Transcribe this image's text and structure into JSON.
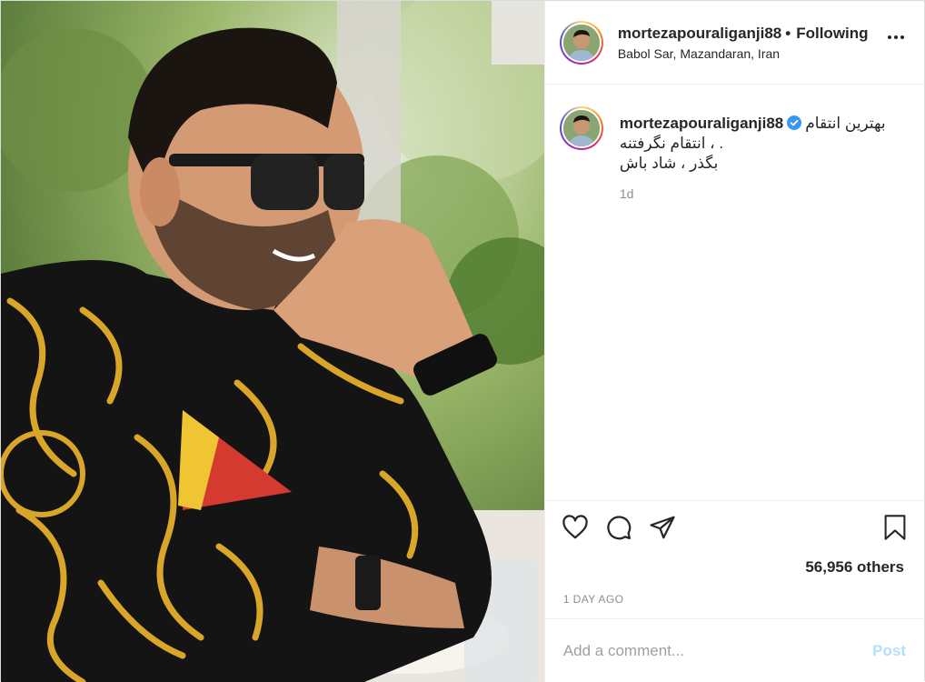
{
  "post": {
    "username": "mortezapouraliganji88",
    "separator": "•",
    "follow_status": "Following",
    "location": "Babol Sar, Mazandaran, Iran",
    "more_icon": "more-horizontal-icon",
    "verified_icon": "verified-badge-icon",
    "caption": {
      "username": "mortezapouraliganji88",
      "line1": "بهترین انتقام",
      "line2": ". ، انتقام نگرفتنه",
      "line3": "بگذر ، شاد باش",
      "time": "1d"
    },
    "actions": {
      "like_icon": "heart-icon",
      "comment_icon": "comment-icon",
      "share_icon": "share-icon",
      "save_icon": "bookmark-icon"
    },
    "likes": "56,956 others",
    "date": "1 DAY AGO",
    "comment_placeholder": "Add a comment...",
    "post_label": "Post"
  },
  "colors": {
    "accent": "#0095f6",
    "post_disabled": "#b2dffc",
    "muted": "#8e8e8e",
    "text": "#262626"
  }
}
